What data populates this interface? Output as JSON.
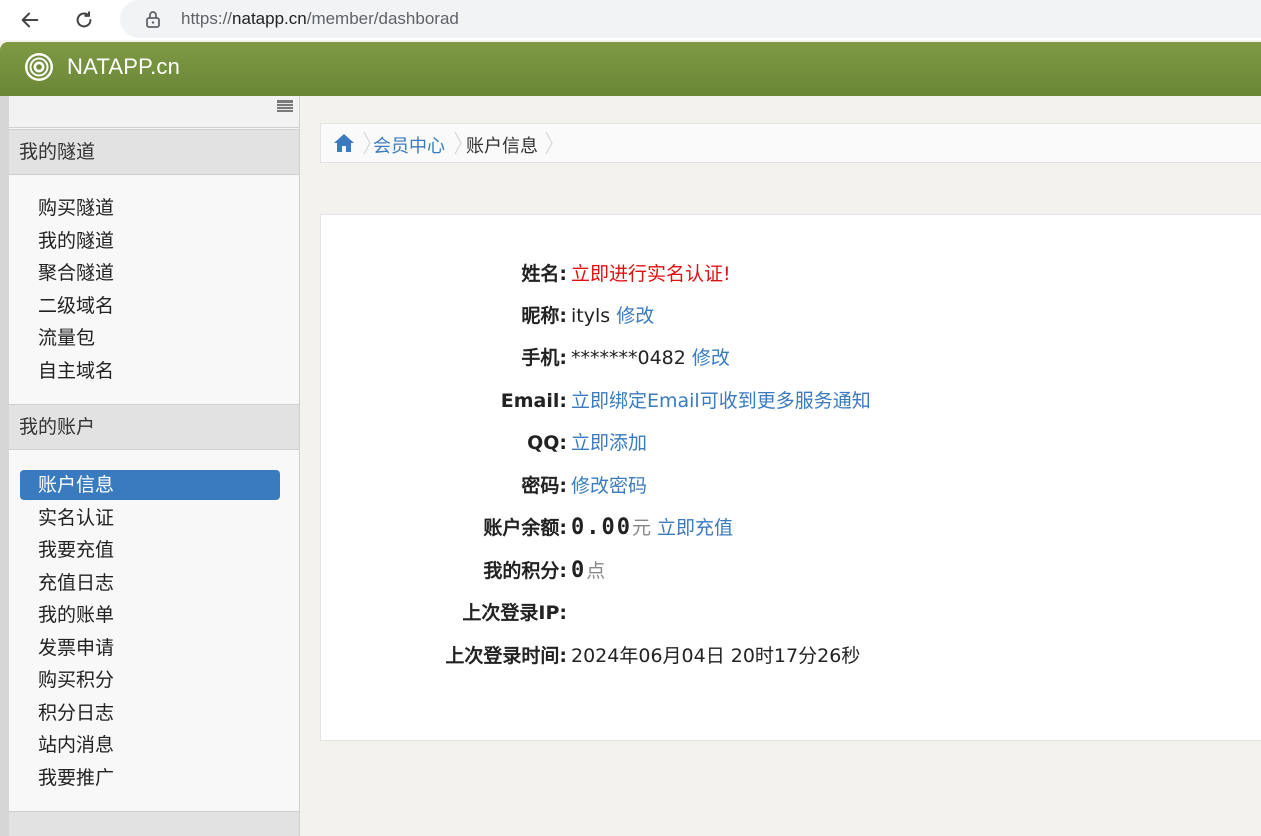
{
  "browser": {
    "url_scheme": "https://",
    "url_host": "natapp.cn",
    "url_path": "/member/dashborad"
  },
  "header": {
    "brand": "NATAPP.cn"
  },
  "sidebar": {
    "sections": [
      {
        "title": "我的隧道",
        "items": [
          "购买隧道",
          "我的隧道",
          "聚合隧道",
          "二级域名",
          "流量包",
          "自主域名"
        ]
      },
      {
        "title": "我的账户",
        "items": [
          "账户信息",
          "实名认证",
          "我要充值",
          "充值日志",
          "我的账单",
          "发票申请",
          "购买积分",
          "积分日志",
          "站内消息",
          "我要推广"
        ]
      }
    ],
    "active_item": "账户信息"
  },
  "breadcrumb": {
    "items": [
      "会员中心",
      "账户信息"
    ]
  },
  "account": {
    "name_label": "姓名:",
    "name_value": "立即进行实名认证!",
    "nickname_label": "昵称:",
    "nickname_value": "ityls",
    "nickname_action": "修改",
    "phone_label": "手机:",
    "phone_value": "*******0482",
    "phone_action": "修改",
    "email_label": "Email:",
    "email_value": "立即绑定Email可收到更多服务通知",
    "qq_label": "QQ:",
    "qq_value": "立即添加",
    "password_label": "密码:",
    "password_value": "修改密码",
    "balance_label": "账户余额:",
    "balance_value": "0.00",
    "balance_unit": "元",
    "balance_action": "立即充值",
    "points_label": "我的积分:",
    "points_value": "0",
    "points_unit": "点",
    "last_ip_label": "上次登录IP:",
    "last_time_label": "上次登录时间:",
    "last_time_value": "2024年06月04日 20时17分26秒"
  },
  "colors": {
    "header_green": "#6f8b3a",
    "link_blue": "#3a7bbf",
    "alert_red": "#e01010"
  }
}
